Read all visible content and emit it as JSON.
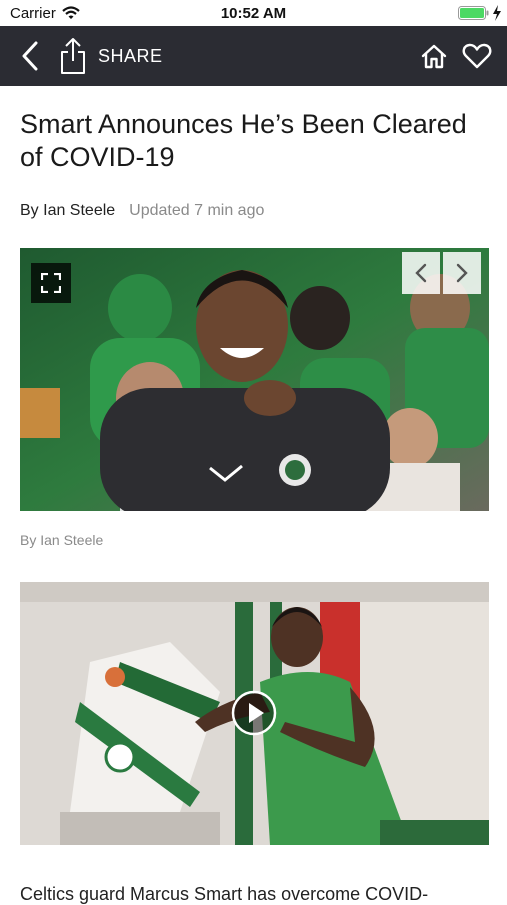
{
  "status_bar": {
    "carrier": "Carrier",
    "time": "10:52 AM"
  },
  "nav": {
    "back_icon": "chevron-left-icon",
    "share_label": "SHARE",
    "share_icon": "share-icon",
    "home_icon": "home-icon",
    "favorite_icon": "heart-icon"
  },
  "article": {
    "headline": "Smart Announces He’s Been Cleared of COVID-19",
    "author": "By Ian Steele",
    "updated": "Updated 7 min ago",
    "photo_credit": "By Ian Steele",
    "lead_text": "Celtics guard Marcus Smart has overcome COVID-"
  },
  "colors": {
    "nav_background": "#2b2c33",
    "celtics_green": "#1e7d3c"
  }
}
